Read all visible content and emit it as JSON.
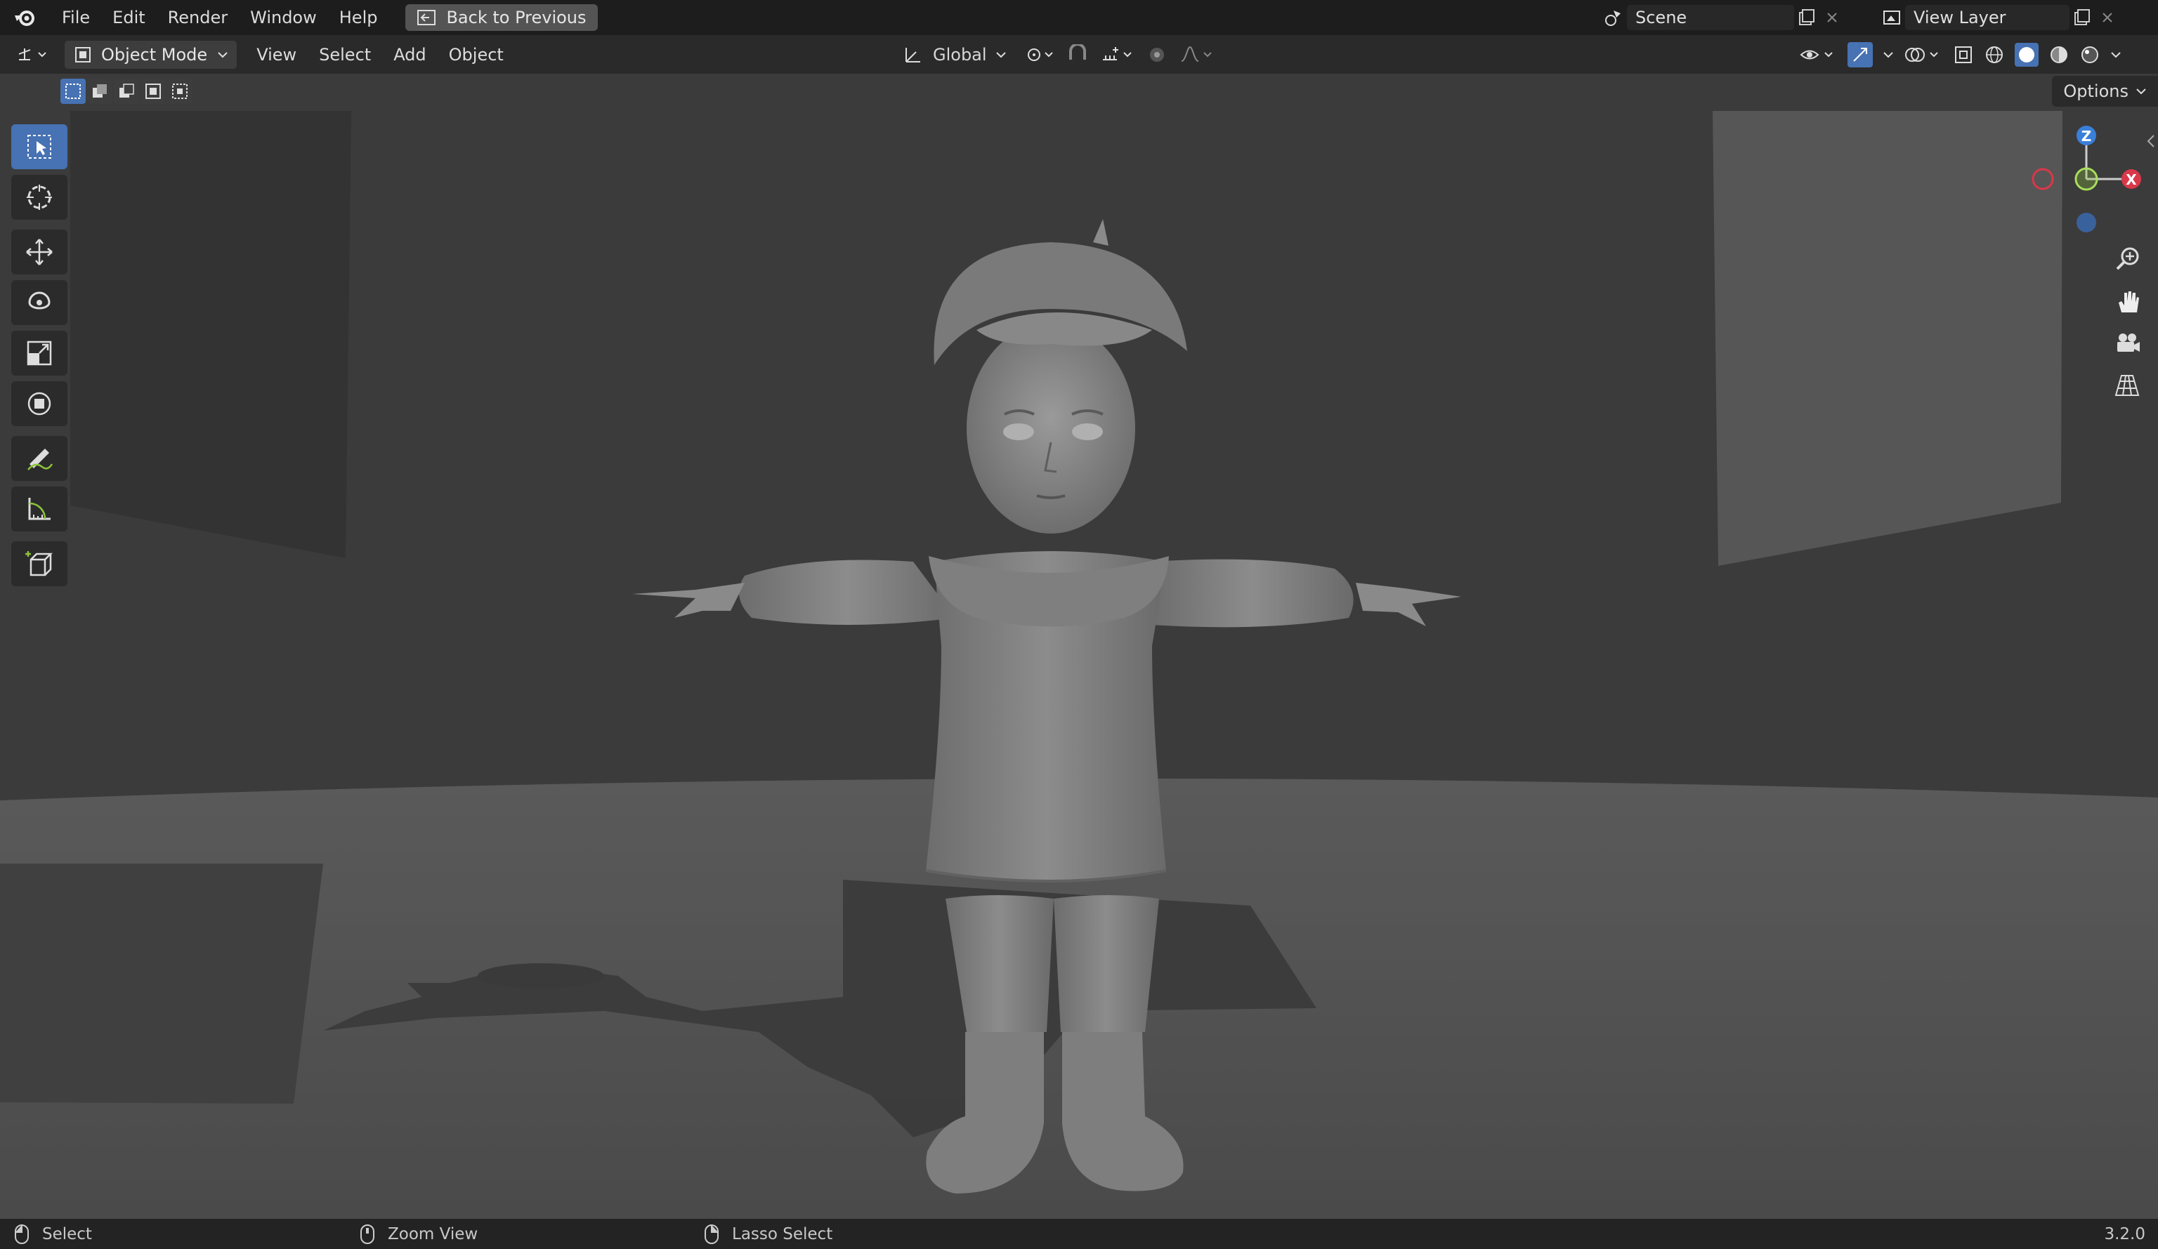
{
  "topbar": {
    "menus": [
      "File",
      "Edit",
      "Render",
      "Window",
      "Help"
    ],
    "back_label": "Back to Previous",
    "scene": "Scene",
    "view_layer": "View Layer"
  },
  "header": {
    "mode": "Object Mode",
    "menus": [
      "View",
      "Select",
      "Add",
      "Object"
    ],
    "orientation": "Global",
    "options_label": "Options"
  },
  "gizmo": {
    "z": "Z",
    "x": "X"
  },
  "status": {
    "left_label": "Select",
    "middle_label": "Zoom View",
    "right_label": "Lasso Select",
    "version": "3.2.0"
  },
  "colors": {
    "accent": "#4772b3",
    "x_axis": "#d9384a",
    "y_axis": "#8cc43a",
    "z_axis": "#3a7fd9"
  }
}
